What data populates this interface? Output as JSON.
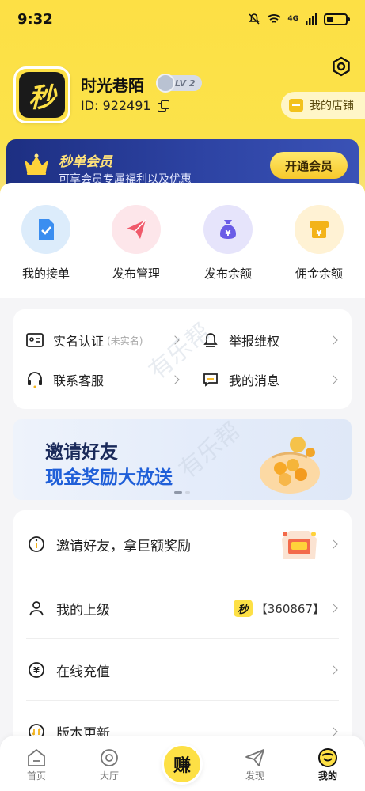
{
  "status_bar": {
    "time": "9:32",
    "network": "4G"
  },
  "profile": {
    "name": "时光巷陌",
    "level": "LV 2",
    "id_text": "ID:  922491",
    "avatar_glyph": "秒",
    "store_label": "我的店铺"
  },
  "member": {
    "title": "秒单会员",
    "subtitle": "可享会员专属福利以及优惠",
    "button": "开通会员"
  },
  "quick_actions": [
    {
      "label": "我的接单",
      "icon": "document-check-icon",
      "bg": "#dcecfb",
      "fg": "#3b8ef0"
    },
    {
      "label": "发布管理",
      "icon": "paper-plane-icon",
      "bg": "#fde6ea",
      "fg": "#f05a6b"
    },
    {
      "label": "发布余额",
      "icon": "money-bag-icon",
      "bg": "#e6e4fb",
      "fg": "#6a5ce6"
    },
    {
      "label": "佣金余额",
      "icon": "wallet-icon",
      "bg": "#fff2d4",
      "fg": "#f3b319"
    }
  ],
  "grid_menu": {
    "realname": {
      "label": "实名认证",
      "note": "(未实名)"
    },
    "report": {
      "label": "举报维权"
    },
    "service": {
      "label": "联系客服"
    },
    "messages": {
      "label": "我的消息"
    }
  },
  "banner": {
    "line1": "邀请好友",
    "line2": "现金奖励大放送"
  },
  "list_menu": {
    "invite": {
      "label": "邀请好友，拿巨额奖励"
    },
    "superior": {
      "label": "我的上级",
      "value": "【360867】",
      "logo_glyph": "秒"
    },
    "recharge": {
      "label": "在线充值"
    },
    "update": {
      "label": "版本更新"
    }
  },
  "watermark": {
    "text": "有乐帮"
  },
  "tabs": {
    "home": "首页",
    "hall": "大厅",
    "earn": "赚",
    "discover": "发现",
    "mine": "我的"
  },
  "colors": {
    "brand_yellow": "#fde045",
    "member_blue": "#2d43a3",
    "accent_blue": "#1f5fd8"
  }
}
